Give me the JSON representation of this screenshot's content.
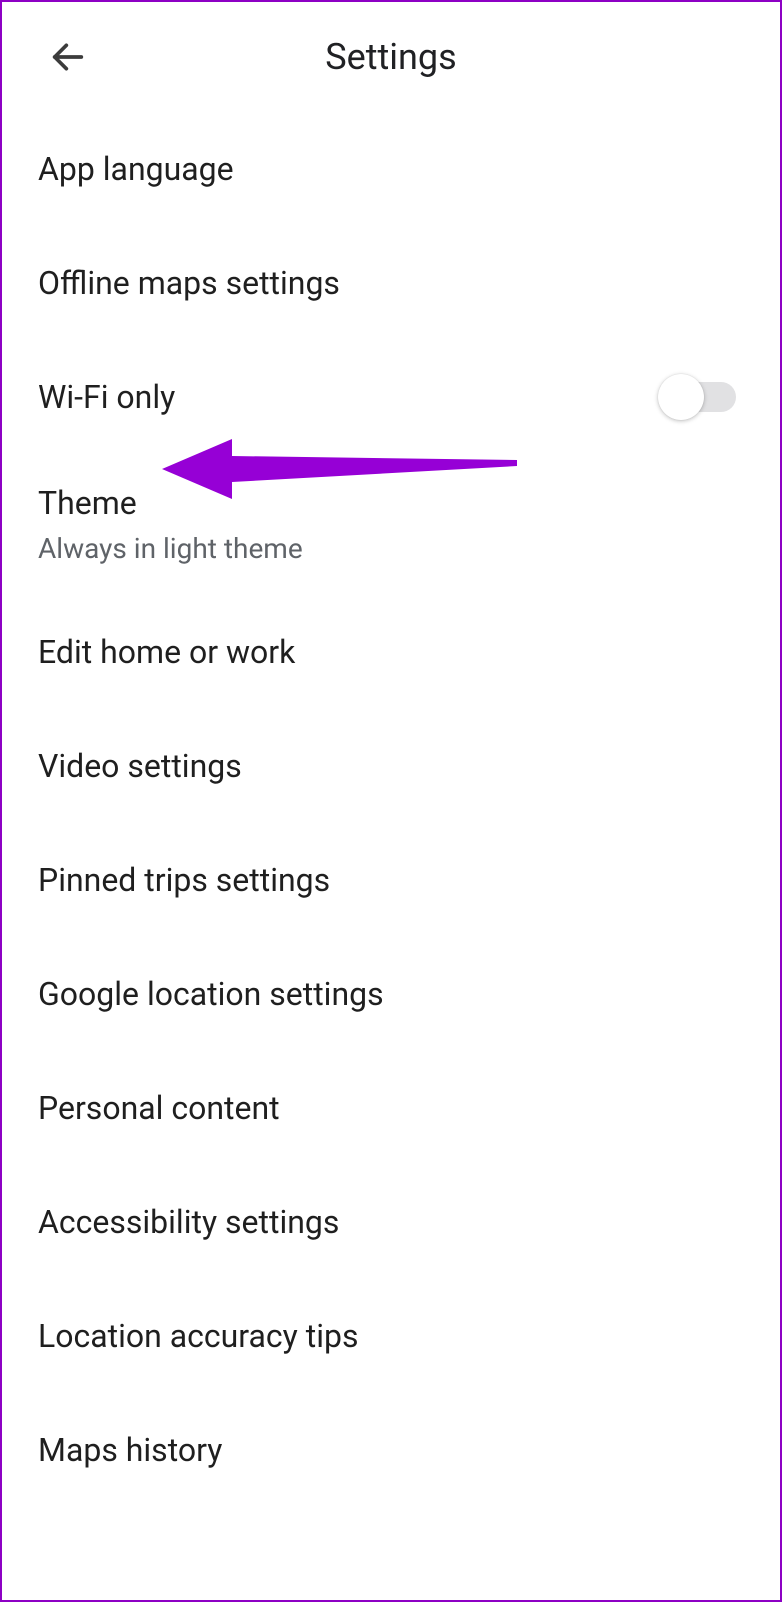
{
  "header": {
    "title": "Settings"
  },
  "items": [
    {
      "title": "App language"
    },
    {
      "title": "Offline maps settings"
    },
    {
      "title": "Wi-Fi only",
      "toggle": false
    },
    {
      "title": "Theme",
      "subtitle": "Always in light theme",
      "annotated": true
    },
    {
      "title": "Edit home or work"
    },
    {
      "title": "Video settings"
    },
    {
      "title": "Pinned trips settings"
    },
    {
      "title": "Google location settings"
    },
    {
      "title": "Personal content"
    },
    {
      "title": "Accessibility settings"
    },
    {
      "title": "Location accuracy tips"
    },
    {
      "title": "Maps history"
    }
  ],
  "annotation": {
    "color": "#9600d6"
  }
}
